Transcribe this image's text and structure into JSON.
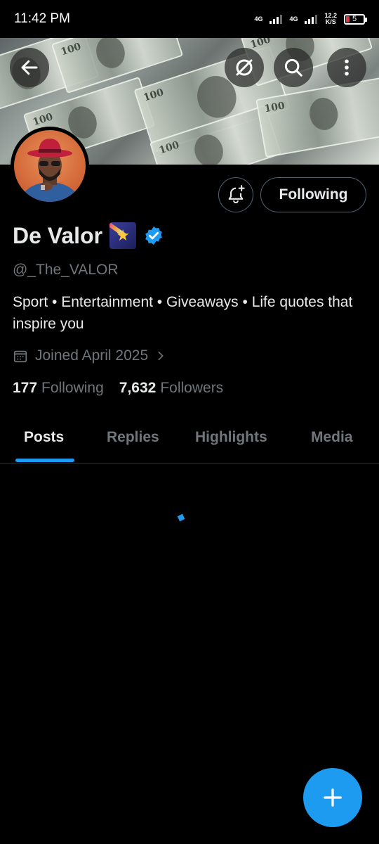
{
  "status_bar": {
    "time": "11:42 PM",
    "net1": "4G",
    "net2": "4G",
    "speed_value": "12.2",
    "speed_unit": "K/S",
    "battery": "5"
  },
  "banner": {
    "bill_text": "100"
  },
  "actions": {
    "following_label": "Following"
  },
  "profile": {
    "name": "De Valor",
    "handle": "@_The_VALOR",
    "bio": "Sport • Entertainment • Giveaways • Life quotes that inspire you",
    "joined": "Joined April 2025",
    "following_count": "177",
    "following_label": "Following",
    "followers_count": "7,632",
    "followers_label": "Followers"
  },
  "tabs": [
    {
      "label": "Posts",
      "active": true
    },
    {
      "label": "Replies",
      "active": false
    },
    {
      "label": "Highlights",
      "active": false
    },
    {
      "label": "Media",
      "active": false
    }
  ],
  "colors": {
    "accent": "#1d9bf0",
    "background": "#000000",
    "secondary_text": "#71767b"
  },
  "icons": [
    "back-arrow-icon",
    "grok-icon",
    "search-icon",
    "more-vertical-icon",
    "bell-plus-icon",
    "verified-badge-icon",
    "calendar-icon",
    "chevron-right-icon",
    "plus-icon",
    "shooting-star-emoji"
  ]
}
